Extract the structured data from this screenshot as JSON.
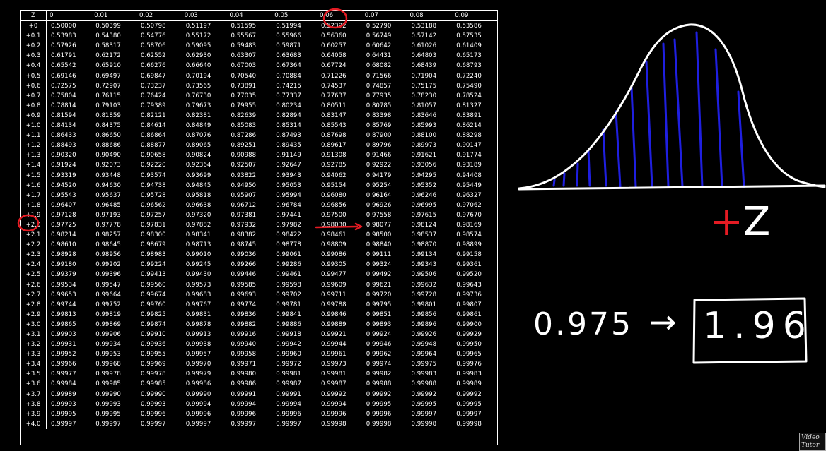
{
  "table": {
    "corner_label": "Z",
    "columns": [
      "0",
      "0.01",
      "0.02",
      "0.03",
      "0.04",
      "0.05",
      "0.06",
      "0.07",
      "0.08",
      "0.09"
    ],
    "rows": [
      {
        "z": "+0",
        "v": [
          "0.50000",
          "0.50399",
          "0.50798",
          "0.51197",
          "0.51595",
          "0.51994",
          "0.52392",
          "0.52790",
          "0.53188",
          "0.53586"
        ]
      },
      {
        "z": "+0.1",
        "v": [
          "0.53983",
          "0.54380",
          "0.54776",
          "0.55172",
          "0.55567",
          "0.55966",
          "0.56360",
          "0.56749",
          "0.57142",
          "0.57535"
        ]
      },
      {
        "z": "+0.2",
        "v": [
          "0.57926",
          "0.58317",
          "0.58706",
          "0.59095",
          "0.59483",
          "0.59871",
          "0.60257",
          "0.60642",
          "0.61026",
          "0.61409"
        ]
      },
      {
        "z": "+0.3",
        "v": [
          "0.61791",
          "0.62172",
          "0.62552",
          "0.62930",
          "0.63307",
          "0.63683",
          "0.64058",
          "0.64431",
          "0.64803",
          "0.65173"
        ]
      },
      {
        "z": "+0.4",
        "v": [
          "0.65542",
          "0.65910",
          "0.66276",
          "0.66640",
          "0.67003",
          "0.67364",
          "0.67724",
          "0.68082",
          "0.68439",
          "0.68793"
        ]
      },
      {
        "z": "+0.5",
        "v": [
          "0.69146",
          "0.69497",
          "0.69847",
          "0.70194",
          "0.70540",
          "0.70884",
          "0.71226",
          "0.71566",
          "0.71904",
          "0.72240"
        ]
      },
      {
        "z": "+0.6",
        "v": [
          "0.72575",
          "0.72907",
          "0.73237",
          "0.73565",
          "0.73891",
          "0.74215",
          "0.74537",
          "0.74857",
          "0.75175",
          "0.75490"
        ]
      },
      {
        "z": "+0.7",
        "v": [
          "0.75804",
          "0.76115",
          "0.76424",
          "0.76730",
          "0.77035",
          "0.77337",
          "0.77637",
          "0.77935",
          "0.78230",
          "0.78524"
        ]
      },
      {
        "z": "+0.8",
        "v": [
          "0.78814",
          "0.79103",
          "0.79389",
          "0.79673",
          "0.79955",
          "0.80234",
          "0.80511",
          "0.80785",
          "0.81057",
          "0.81327"
        ]
      },
      {
        "z": "+0.9",
        "v": [
          "0.81594",
          "0.81859",
          "0.82121",
          "0.82381",
          "0.82639",
          "0.82894",
          "0.83147",
          "0.83398",
          "0.83646",
          "0.83891"
        ]
      },
      {
        "z": "+1.0",
        "v": [
          "0.84134",
          "0.84375",
          "0.84614",
          "0.84849",
          "0.85083",
          "0.85314",
          "0.85543",
          "0.85769",
          "0.85993",
          "0.86214"
        ]
      },
      {
        "z": "+1.1",
        "v": [
          "0.86433",
          "0.86650",
          "0.86864",
          "0.87076",
          "0.87286",
          "0.87493",
          "0.87698",
          "0.87900",
          "0.88100",
          "0.88298"
        ]
      },
      {
        "z": "+1.2",
        "v": [
          "0.88493",
          "0.88686",
          "0.88877",
          "0.89065",
          "0.89251",
          "0.89435",
          "0.89617",
          "0.89796",
          "0.89973",
          "0.90147"
        ]
      },
      {
        "z": "+1.3",
        "v": [
          "0.90320",
          "0.90490",
          "0.90658",
          "0.90824",
          "0.90988",
          "0.91149",
          "0.91308",
          "0.91466",
          "0.91621",
          "0.91774"
        ]
      },
      {
        "z": "+1.4",
        "v": [
          "0.91924",
          "0.92073",
          "0.92220",
          "0.92364",
          "0.92507",
          "0.92647",
          "0.92785",
          "0.92922",
          "0.93056",
          "0.93189"
        ]
      },
      {
        "z": "+1.5",
        "v": [
          "0.93319",
          "0.93448",
          "0.93574",
          "0.93699",
          "0.93822",
          "0.93943",
          "0.94062",
          "0.94179",
          "0.94295",
          "0.94408"
        ]
      },
      {
        "z": "+1.6",
        "v": [
          "0.94520",
          "0.94630",
          "0.94738",
          "0.94845",
          "0.94950",
          "0.95053",
          "0.95154",
          "0.95254",
          "0.95352",
          "0.95449"
        ]
      },
      {
        "z": "+1.7",
        "v": [
          "0.95543",
          "0.95637",
          "0.95728",
          "0.95818",
          "0.95907",
          "0.95994",
          "0.96080",
          "0.96164",
          "0.96246",
          "0.96327"
        ]
      },
      {
        "z": "+1.8",
        "v": [
          "0.96407",
          "0.96485",
          "0.96562",
          "0.96638",
          "0.96712",
          "0.96784",
          "0.96856",
          "0.96926",
          "0.96995",
          "0.97062"
        ]
      },
      {
        "z": "+1.9",
        "v": [
          "0.97128",
          "0.97193",
          "0.97257",
          "0.97320",
          "0.97381",
          "0.97441",
          "0.97500",
          "0.97558",
          "0.97615",
          "0.97670"
        ]
      },
      {
        "z": "+2.0",
        "v": [
          "0.97725",
          "0.97778",
          "0.97831",
          "0.97882",
          "0.97932",
          "0.97982",
          "0.98030",
          "0.98077",
          "0.98124",
          "0.98169"
        ]
      },
      {
        "z": "+2.1",
        "v": [
          "0.98214",
          "0.98257",
          "0.98300",
          "0.98341",
          "0.98382",
          "0.98422",
          "0.98461",
          "0.98500",
          "0.98537",
          "0.98574"
        ]
      },
      {
        "z": "+2.2",
        "v": [
          "0.98610",
          "0.98645",
          "0.98679",
          "0.98713",
          "0.98745",
          "0.98778",
          "0.98809",
          "0.98840",
          "0.98870",
          "0.98899"
        ]
      },
      {
        "z": "+2.3",
        "v": [
          "0.98928",
          "0.98956",
          "0.98983",
          "0.99010",
          "0.99036",
          "0.99061",
          "0.99086",
          "0.99111",
          "0.99134",
          "0.99158"
        ]
      },
      {
        "z": "+2.4",
        "v": [
          "0.99180",
          "0.99202",
          "0.99224",
          "0.99245",
          "0.99266",
          "0.99286",
          "0.99305",
          "0.99324",
          "0.99343",
          "0.99361"
        ]
      },
      {
        "z": "+2.5",
        "v": [
          "0.99379",
          "0.99396",
          "0.99413",
          "0.99430",
          "0.99446",
          "0.99461",
          "0.99477",
          "0.99492",
          "0.99506",
          "0.99520"
        ]
      },
      {
        "z": "+2.6",
        "v": [
          "0.99534",
          "0.99547",
          "0.99560",
          "0.99573",
          "0.99585",
          "0.99598",
          "0.99609",
          "0.99621",
          "0.99632",
          "0.99643"
        ]
      },
      {
        "z": "+2.7",
        "v": [
          "0.99653",
          "0.99664",
          "0.99674",
          "0.99683",
          "0.99693",
          "0.99702",
          "0.99711",
          "0.99720",
          "0.99728",
          "0.99736"
        ]
      },
      {
        "z": "+2.8",
        "v": [
          "0.99744",
          "0.99752",
          "0.99760",
          "0.99767",
          "0.99774",
          "0.99781",
          "0.99788",
          "0.99795",
          "0.99801",
          "0.99807"
        ]
      },
      {
        "z": "+2.9",
        "v": [
          "0.99813",
          "0.99819",
          "0.99825",
          "0.99831",
          "0.99836",
          "0.99841",
          "0.99846",
          "0.99851",
          "0.99856",
          "0.99861"
        ]
      },
      {
        "z": "+3.0",
        "v": [
          "0.99865",
          "0.99869",
          "0.99874",
          "0.99878",
          "0.99882",
          "0.99886",
          "0.99889",
          "0.99893",
          "0.99896",
          "0.99900"
        ]
      },
      {
        "z": "+3.1",
        "v": [
          "0.99903",
          "0.99906",
          "0.99910",
          "0.99913",
          "0.99916",
          "0.99918",
          "0.99921",
          "0.99924",
          "0.99926",
          "0.99929"
        ]
      },
      {
        "z": "+3.2",
        "v": [
          "0.99931",
          "0.99934",
          "0.99936",
          "0.99938",
          "0.99940",
          "0.99942",
          "0.99944",
          "0.99946",
          "0.99948",
          "0.99950"
        ]
      },
      {
        "z": "+3.3",
        "v": [
          "0.99952",
          "0.99953",
          "0.99955",
          "0.99957",
          "0.99958",
          "0.99960",
          "0.99961",
          "0.99962",
          "0.99964",
          "0.99965"
        ]
      },
      {
        "z": "+3.4",
        "v": [
          "0.99966",
          "0.99968",
          "0.99969",
          "0.99970",
          "0.99971",
          "0.99972",
          "0.99973",
          "0.99974",
          "0.99975",
          "0.99976"
        ]
      },
      {
        "z": "+3.5",
        "v": [
          "0.99977",
          "0.99978",
          "0.99978",
          "0.99979",
          "0.99980",
          "0.99981",
          "0.99981",
          "0.99982",
          "0.99983",
          "0.99983"
        ]
      },
      {
        "z": "+3.6",
        "v": [
          "0.99984",
          "0.99985",
          "0.99985",
          "0.99986",
          "0.99986",
          "0.99987",
          "0.99987",
          "0.99988",
          "0.99988",
          "0.99989"
        ]
      },
      {
        "z": "+3.7",
        "v": [
          "0.99989",
          "0.99990",
          "0.99990",
          "0.99990",
          "0.99991",
          "0.99991",
          "0.99992",
          "0.99992",
          "0.99992",
          "0.99992"
        ]
      },
      {
        "z": "+3.8",
        "v": [
          "0.99993",
          "0.99993",
          "0.99993",
          "0.99994",
          "0.99994",
          "0.99994",
          "0.99994",
          "0.99995",
          "0.99995",
          "0.99995"
        ]
      },
      {
        "z": "+3.9",
        "v": [
          "0.99995",
          "0.99995",
          "0.99996",
          "0.99996",
          "0.99996",
          "0.99996",
          "0.99996",
          "0.99996",
          "0.99997",
          "0.99997"
        ]
      },
      {
        "z": "+4.0",
        "v": [
          "0.99997",
          "0.99997",
          "0.99997",
          "0.99997",
          "0.99997",
          "0.99997",
          "0.99998",
          "0.99998",
          "0.99998",
          "0.99998"
        ]
      }
    ]
  },
  "annotations": {
    "highlight_row": "+1.9",
    "highlight_column": "0.06",
    "highlight_value": "0.97500",
    "plus_z_label": "+Z",
    "result_input": "0.975",
    "arrow": "→",
    "result_output": "1.96",
    "ink_color": "#ffffff",
    "circle_color": "#e41b23",
    "shade_color": "#1f1fe0"
  },
  "watermark": "Video Tutor"
}
